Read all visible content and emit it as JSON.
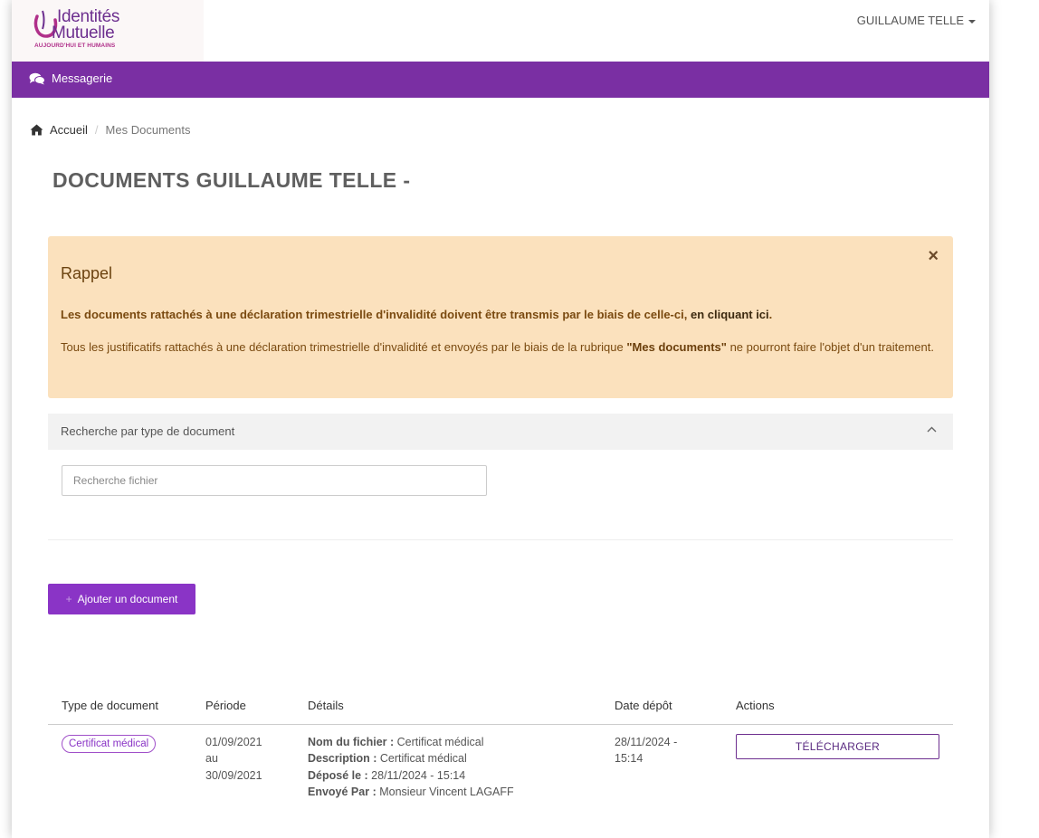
{
  "header": {
    "logo": {
      "line1": "Identités",
      "line2": "Mutuelle",
      "tagline": "AUJOURD'HUI ET HUMAINS"
    },
    "user_name": "GUILLAUME TELLE",
    "icons": {
      "user_menu": "caret-down-icon"
    }
  },
  "navbar": {
    "items": [
      {
        "label": "Messagerie",
        "icon": "comments-icon"
      }
    ],
    "color": "#7a2fa3"
  },
  "breadcrumb": {
    "home": "Accueil",
    "home_icon": "home-icon",
    "separator": "/",
    "current": "Mes Documents"
  },
  "page_title": "DOCUMENTS GUILLAUME TELLE -",
  "alert": {
    "title": "Rappel",
    "close": "×",
    "p1_text": "Les documents rattachés à une déclaration trimestrielle d'invalidité doivent être transmis par le biais de celle-ci,",
    "p1_link": "en cliquant ici",
    "p1_end": ".",
    "p2_start": "Tous les justificatifs rattachés à une déclaration trimestrielle d'invalidité et envoyés par le biais de la rubrique",
    "p2_bold": "\"Mes documents\"",
    "p2_end": "ne pourront faire l'objet d'un traitement.",
    "background": "#fbe1bd"
  },
  "search_panel": {
    "title": "Recherche par type de document",
    "toggle_icon": "chevron-up-icon",
    "input_placeholder": "Recherche fichier"
  },
  "add_button": {
    "label": "Ajouter un document",
    "icon": "plus-icon",
    "color": "#8a34c6"
  },
  "table": {
    "headers": {
      "type": "Type de document",
      "periode": "Période",
      "details": "Détails",
      "date": "Date dépôt",
      "actions": "Actions"
    },
    "rows": [
      {
        "type_badge": "Certificat médical",
        "periode_from": "01/09/2021",
        "periode_au": "au",
        "periode_to": "30/09/2021",
        "details": {
          "nom_label": "Nom du fichier :",
          "nom_value": "Certificat médical",
          "desc_label": "Description :",
          "desc_value": "Certificat médical",
          "depose_label": "Déposé le :",
          "depose_value": "28/11/2024 - 15:14",
          "envoye_label": "Envoyé Par :",
          "envoye_value": "Monsieur Vincent LAGAFF"
        },
        "date_line1": "28/11/2024 -",
        "date_line2": "15:14",
        "action_label": "TÉLÉCHARGER"
      }
    ]
  }
}
